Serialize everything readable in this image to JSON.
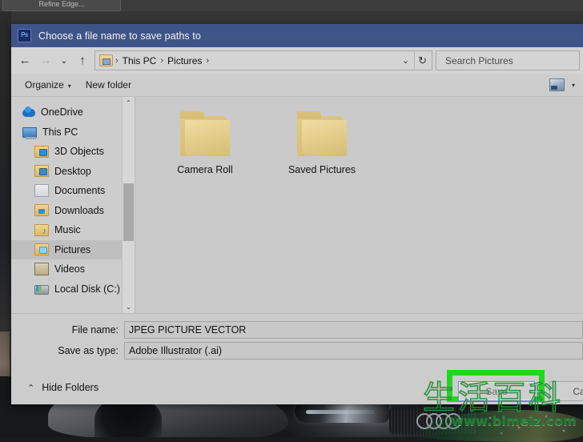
{
  "app": {
    "refine_edge_button": "Refine Edge..."
  },
  "dialog": {
    "title": "Choose a file name to save paths to",
    "app_icon_text": "Ps",
    "nav": {
      "back_icon": "←",
      "forward_icon": "→",
      "recent_icon": "⌄",
      "up_icon": "↑",
      "dropdown_icon": "⌄",
      "refresh_icon": "↻"
    },
    "breadcrumb": {
      "items": [
        "This PC",
        "Pictures"
      ],
      "separator": "›",
      "trailing_separator": "›"
    },
    "search": {
      "placeholder": "Search Pictures",
      "value": ""
    },
    "commandbar": {
      "organize_label": "Organize",
      "organize_caret": "▾",
      "new_folder_label": "New folder",
      "view_caret": "▾"
    },
    "sidebar": {
      "items": [
        {
          "label": "OneDrive",
          "icon": "onedrive-icon",
          "indent": false,
          "selected": false
        },
        {
          "label": "This PC",
          "icon": "this-pc-icon",
          "indent": false,
          "selected": false
        },
        {
          "label": "3D Objects",
          "icon": "folder-3d-objects-icon",
          "indent": true,
          "selected": false
        },
        {
          "label": "Desktop",
          "icon": "folder-desktop-icon",
          "indent": true,
          "selected": false
        },
        {
          "label": "Documents",
          "icon": "folder-documents-icon",
          "indent": true,
          "selected": false
        },
        {
          "label": "Downloads",
          "icon": "folder-downloads-icon",
          "indent": true,
          "selected": false
        },
        {
          "label": "Music",
          "icon": "folder-music-icon",
          "indent": true,
          "selected": false
        },
        {
          "label": "Pictures",
          "icon": "folder-pictures-icon",
          "indent": true,
          "selected": true
        },
        {
          "label": "Videos",
          "icon": "folder-videos-icon",
          "indent": true,
          "selected": false
        },
        {
          "label": "Local Disk (C:)",
          "icon": "local-disk-icon",
          "indent": true,
          "selected": false
        }
      ],
      "scroll_up_icon": "⌃",
      "scroll_down_icon": "⌄"
    },
    "files": [
      {
        "name": "Camera Roll",
        "type": "folder"
      },
      {
        "name": "Saved Pictures",
        "type": "folder"
      }
    ],
    "form": {
      "file_name_label": "File name:",
      "file_name_value": "JPEG PICTURE VECTOR",
      "save_as_type_label": "Save as type:",
      "save_as_type_value": "Adobe Illustrator (.ai)"
    },
    "footer": {
      "hide_folders_chevron": "⌃",
      "hide_folders_label": "Hide Folders",
      "save_button": "Save",
      "cancel_button": "Cancel"
    }
  },
  "annotation": {
    "highlight_color": "#22d522",
    "target": "save-button"
  },
  "watermark": {
    "cjk_text": "生活百科",
    "url_text": "www.bimeiz.com",
    "color": "#1d7d34"
  }
}
